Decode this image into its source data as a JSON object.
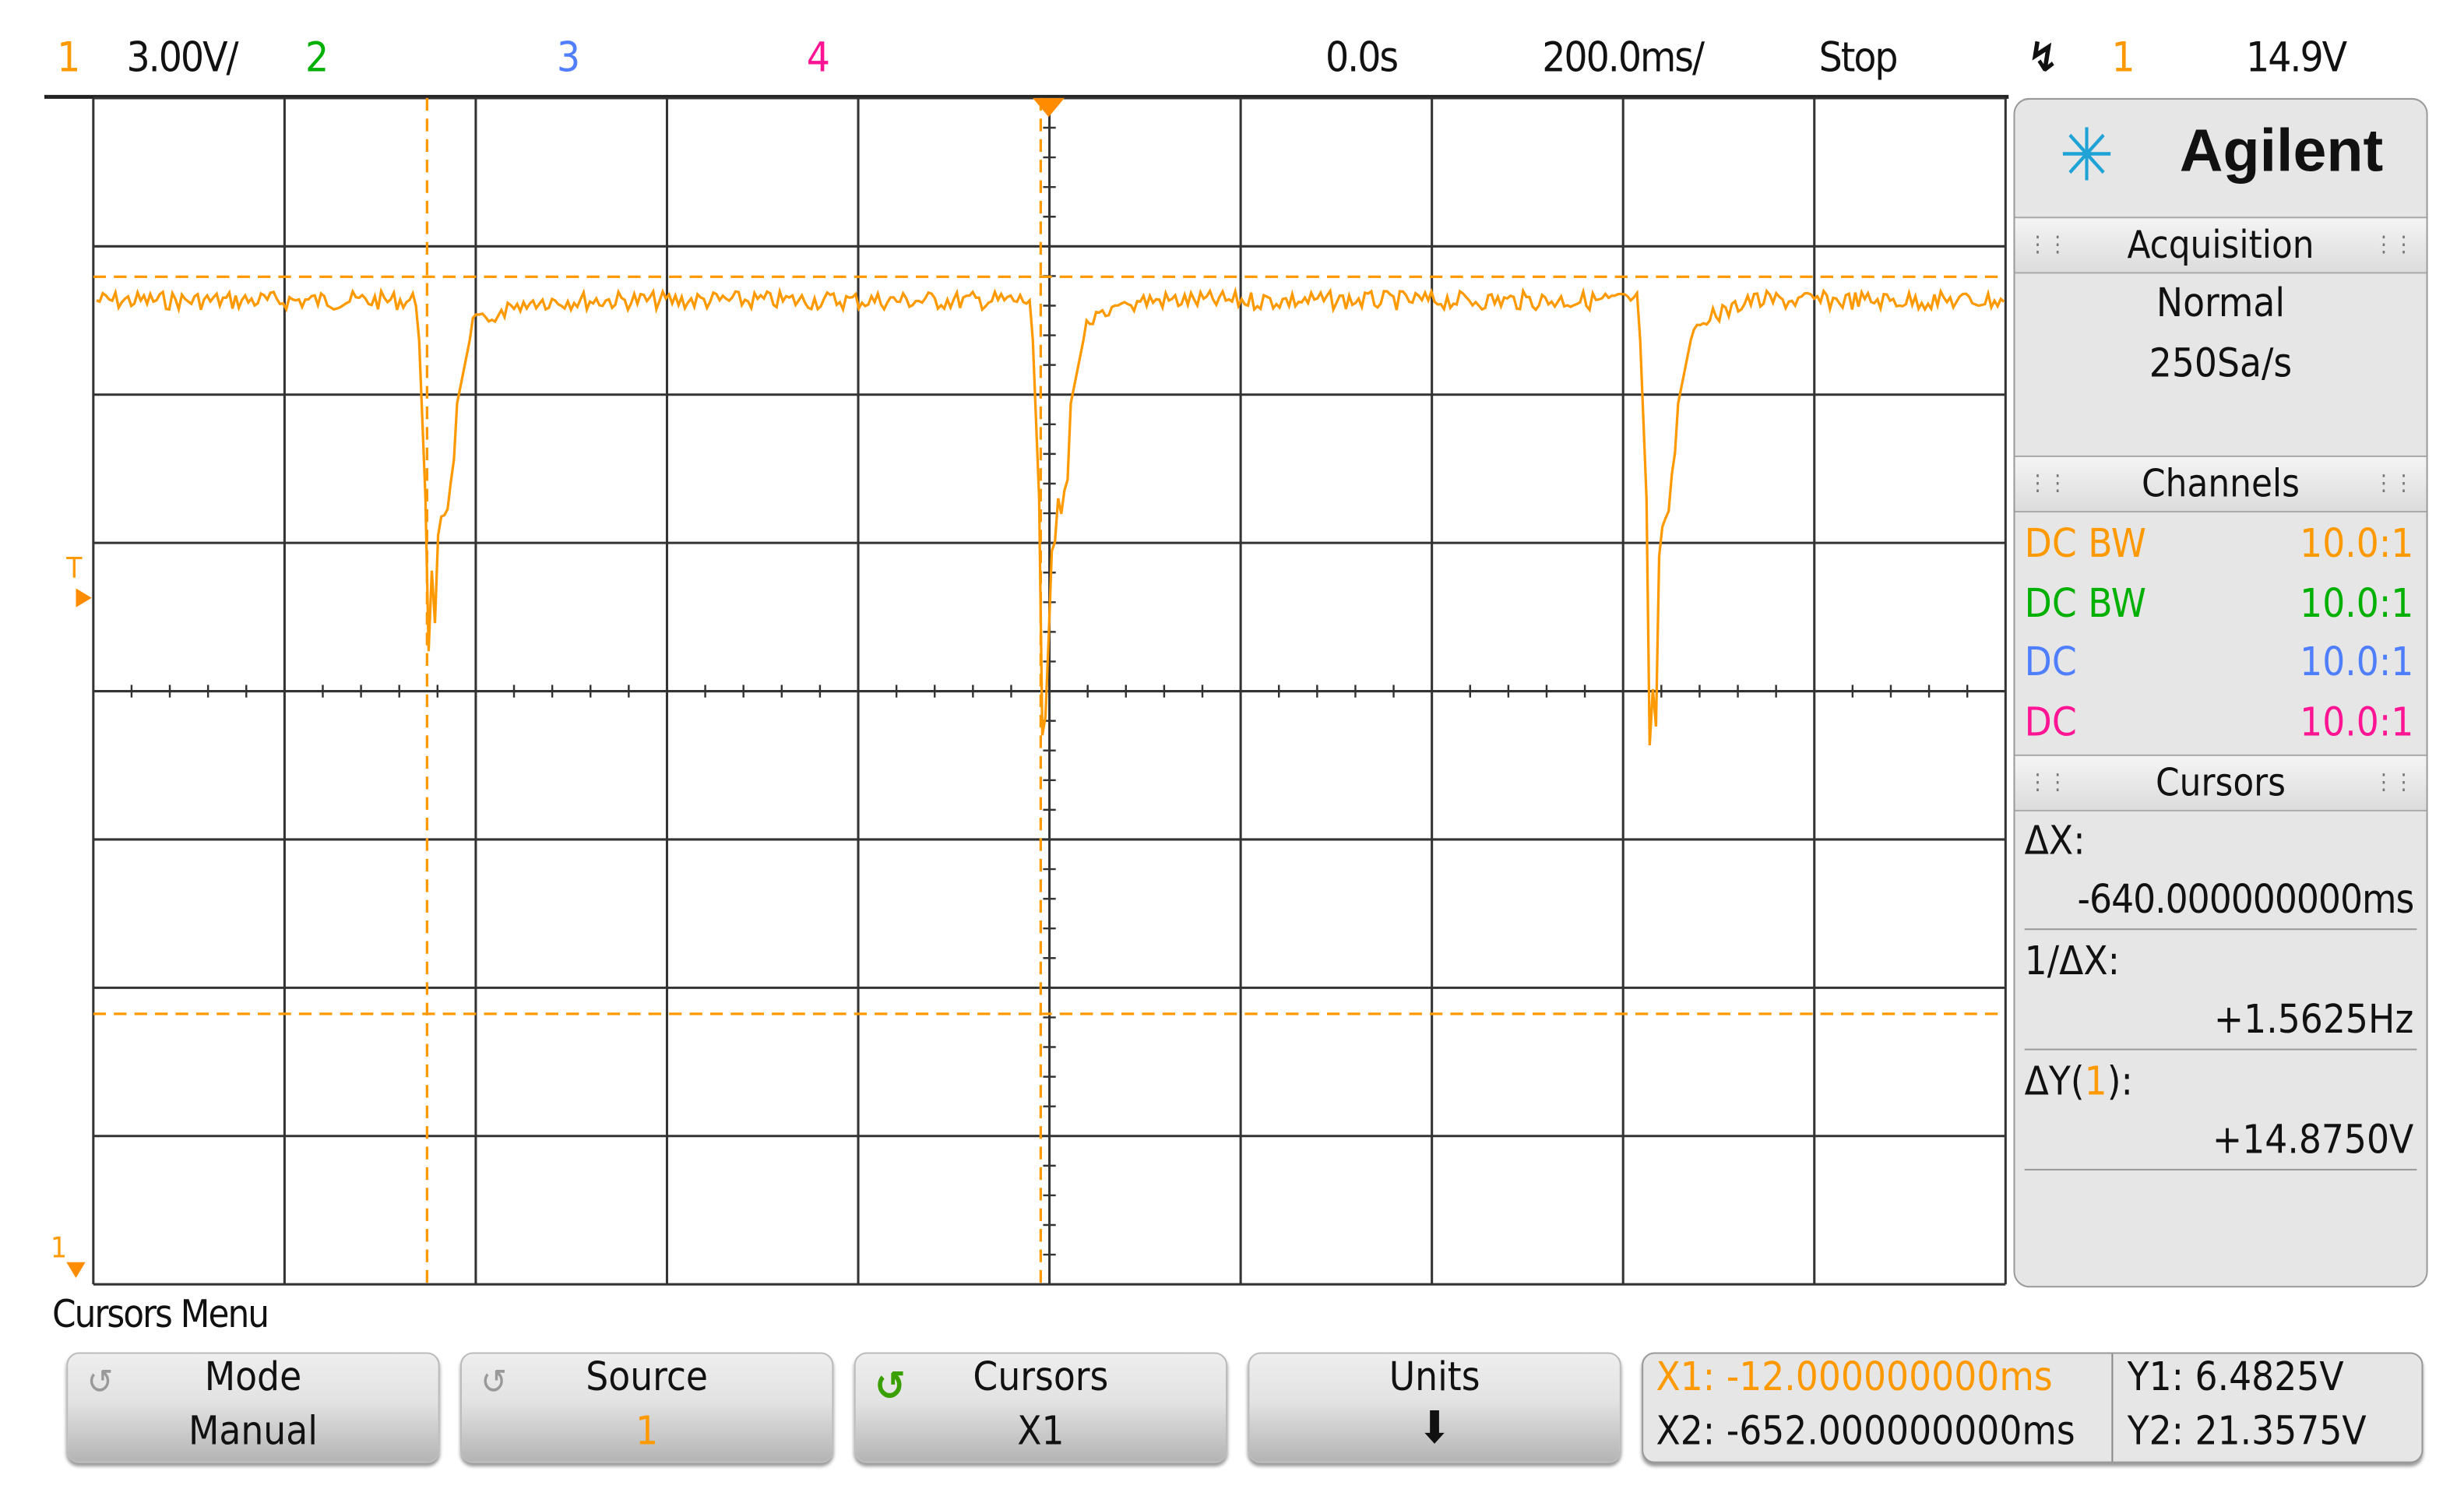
{
  "top_bar": {
    "ch1_label": "1",
    "ch1_scale": "3.00V/",
    "ch2_label": "2",
    "ch3_label": "3",
    "ch4_label": "4",
    "time_offset": "0.0s",
    "time_scale": "200.0ms/",
    "run_state": "Stop",
    "trigger_icon": "falling-edge-icon",
    "trigger_source": "1",
    "trigger_level": "14.9V"
  },
  "colors": {
    "ch1": "#ff9900",
    "ch2": "#00b000",
    "ch3": "#4f7fff",
    "ch4": "#ff1493"
  },
  "screen": {
    "trigger_marker": "T",
    "ch1_ground_marker": "1"
  },
  "panel": {
    "brand": "Agilent",
    "acquisition": {
      "title": "Acquisition",
      "mode": "Normal",
      "rate": "250Sa/s"
    },
    "channels": {
      "title": "Channels",
      "rows": [
        {
          "coupling": "DC BW",
          "probe": "10.0:1"
        },
        {
          "coupling": "DC BW",
          "probe": "10.0:1"
        },
        {
          "coupling": "DC",
          "probe": "10.0:1"
        },
        {
          "coupling": "DC",
          "probe": "10.0:1"
        }
      ]
    },
    "cursors": {
      "title": "Cursors",
      "dx_label": "ΔX:",
      "dx_value": "-640.000000000ms",
      "inv_dx_label": "1/ΔX:",
      "inv_dx_value": "+1.5625Hz",
      "dy_label_pre": "ΔY(",
      "dy_channel": "1",
      "dy_label_post": "):",
      "dy_value": "+14.8750V"
    }
  },
  "menu": {
    "title": "Cursors Menu",
    "buttons": [
      {
        "label": "Mode",
        "value": "Manual"
      },
      {
        "label": "Source",
        "value": "1"
      },
      {
        "label": "Cursors",
        "value": "X1"
      },
      {
        "label": "Units",
        "value": ""
      }
    ],
    "readout": {
      "x1": "X1: -12.000000000ms",
      "x2": "X2: -652.000000000ms",
      "y1": "Y1: 6.4825V",
      "y2": "Y2: 21.3575V"
    }
  }
}
